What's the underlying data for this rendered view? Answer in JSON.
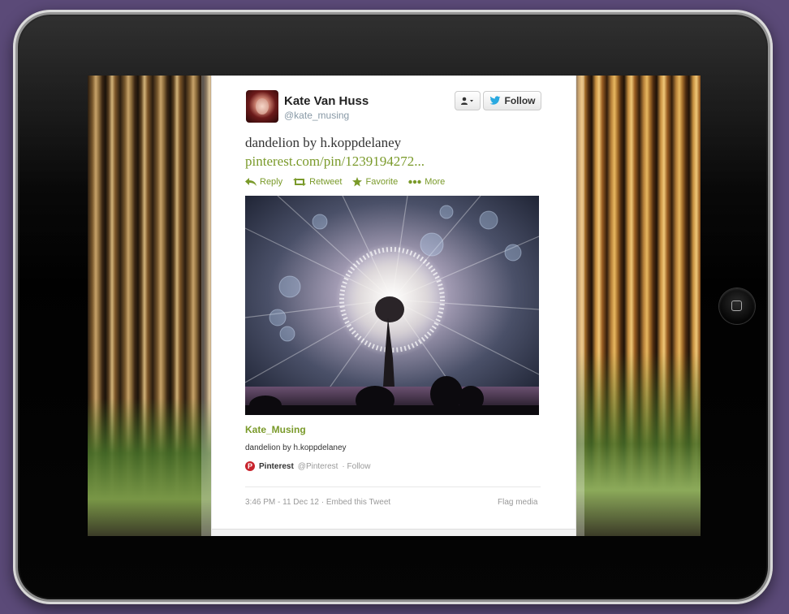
{
  "tweet": {
    "fullname": "Kate Van Huss",
    "screen_name": "@kate_musing",
    "follow_label": "Follow",
    "text": "dandelion by h.koppdelaney",
    "link": "pinterest.com/pin/1239194272...",
    "actions": {
      "reply": "Reply",
      "retweet": "Retweet",
      "favorite": "Favorite",
      "more": "More"
    },
    "card": {
      "author": "Kate_Musing",
      "description": "dandelion by h.koppdelaney",
      "source_name": "Pinterest",
      "source_handle": "@Pinterest",
      "source_follow": "· Follow"
    },
    "timestamp": "3:46 PM - 11 Dec 12 · Embed this Tweet",
    "flag_media": "Flag media"
  },
  "colors": {
    "link_green": "#7a9a2a",
    "twitter_blue": "#2aa9e0",
    "pinterest_red": "#c8232c",
    "frame_background": "#5b4a78"
  },
  "icons": [
    "user-menu-icon",
    "twitter-bird-icon",
    "reply-icon",
    "retweet-icon",
    "favorite-icon",
    "more-icon",
    "pinterest-icon",
    "home-button-icon"
  ]
}
